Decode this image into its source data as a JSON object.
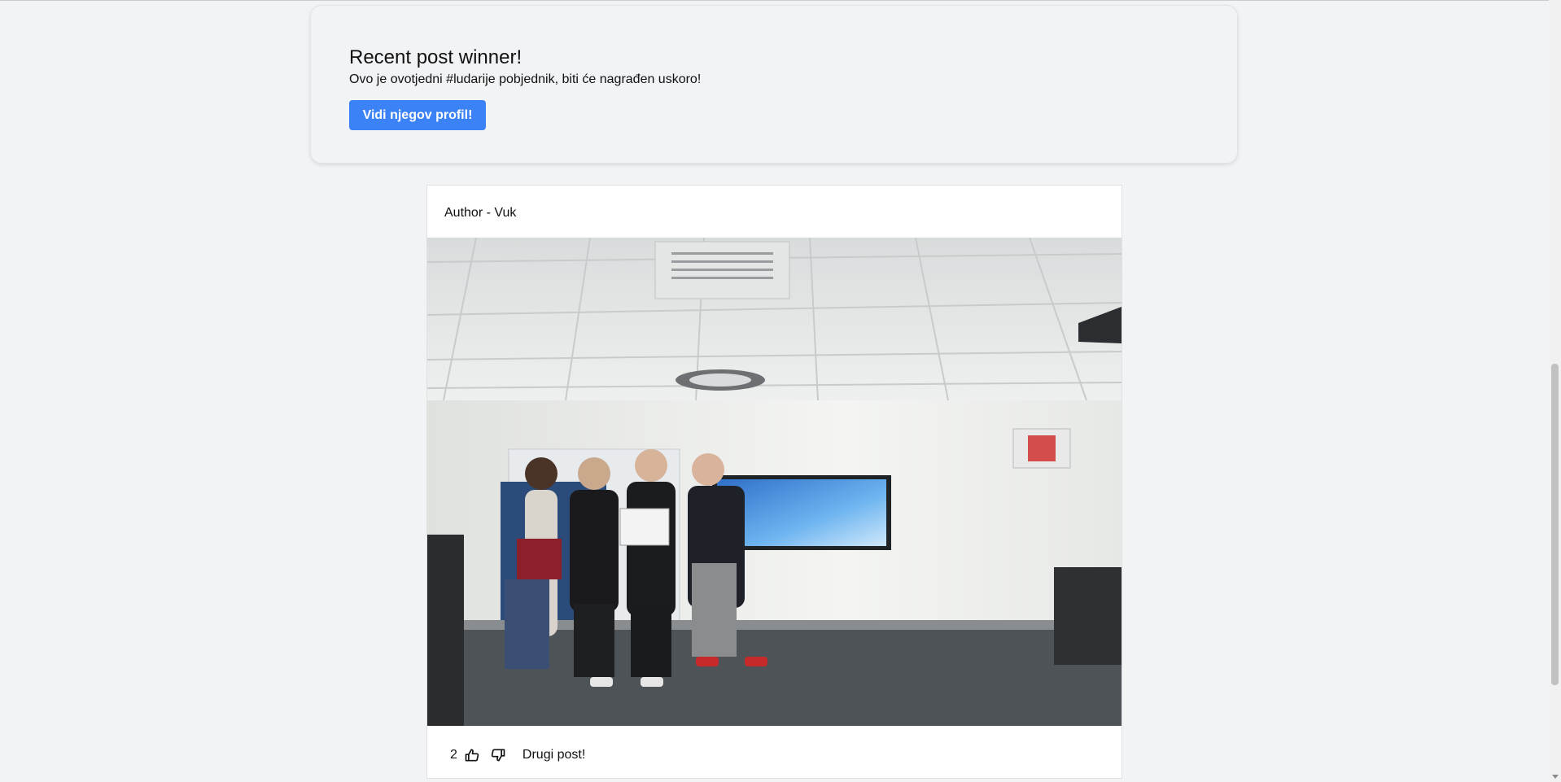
{
  "winner": {
    "title": "Recent post winner!",
    "text": "Ovo je ovotjedni #ludarije pobjednik, biti će nagrađen uskoro!",
    "button_label": "Vidi njegov profil!"
  },
  "post": {
    "author": "Author - Vuk",
    "photo_icon": "group-photo",
    "likes": "2",
    "like_icon": "thumbs-up-icon",
    "dislike_icon": "thumbs-down-icon",
    "title": "Drugi post!"
  },
  "colors": {
    "accent": "#3b82f6",
    "background": "#f2f3f5"
  }
}
